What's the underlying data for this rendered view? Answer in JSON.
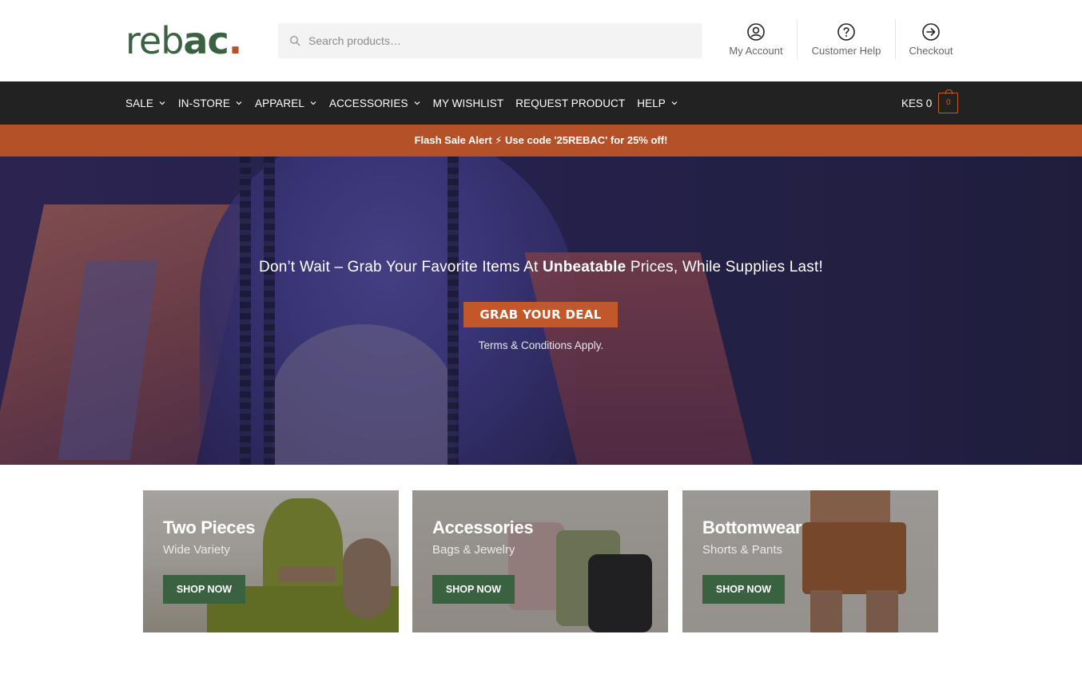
{
  "brand": {
    "logo_light": "reb",
    "logo_bold": "ac",
    "logo_dot": ".",
    "accent": "#b55128",
    "green": "#3a6140"
  },
  "search": {
    "placeholder": "Search products…",
    "icon": "search-icon"
  },
  "header_links": [
    {
      "label": "My Account",
      "icon": "user-circle-icon"
    },
    {
      "label": "Customer Help",
      "icon": "question-circle-icon"
    },
    {
      "label": "Checkout",
      "icon": "arrow-circle-right-icon"
    }
  ],
  "nav": {
    "items": [
      {
        "label": "SALE",
        "has_dropdown": true
      },
      {
        "label": "IN-STORE",
        "has_dropdown": true
      },
      {
        "label": "APPAREL",
        "has_dropdown": true
      },
      {
        "label": "ACCESSORIES",
        "has_dropdown": true
      },
      {
        "label": "MY WISHLIST",
        "has_dropdown": false
      },
      {
        "label": "REQUEST PRODUCT",
        "has_dropdown": false
      },
      {
        "label": "HELP",
        "has_dropdown": true
      }
    ],
    "cart_total": "KES 0",
    "cart_count": "0"
  },
  "flash": {
    "text": "Flash Sale Alert ⚡ Use code '25REBAC' for 25% off!"
  },
  "hero": {
    "text_before": "Don’t Wait – Grab Your Favorite Items At ",
    "text_bold": "Unbeatable",
    "text_after": " Prices, While Supplies Last!",
    "button": "GRAB YOUR DEAL",
    "terms": "Terms & Conditions Apply."
  },
  "categories": [
    {
      "title": "Two Pieces",
      "subtitle": "Wide Variety",
      "button": "SHOP NOW"
    },
    {
      "title": "Accessories",
      "subtitle": "Bags & Jewelry",
      "button": "SHOP NOW"
    },
    {
      "title": "Bottomwear",
      "subtitle": "Shorts & Pants",
      "button": "SHOP NOW"
    }
  ]
}
